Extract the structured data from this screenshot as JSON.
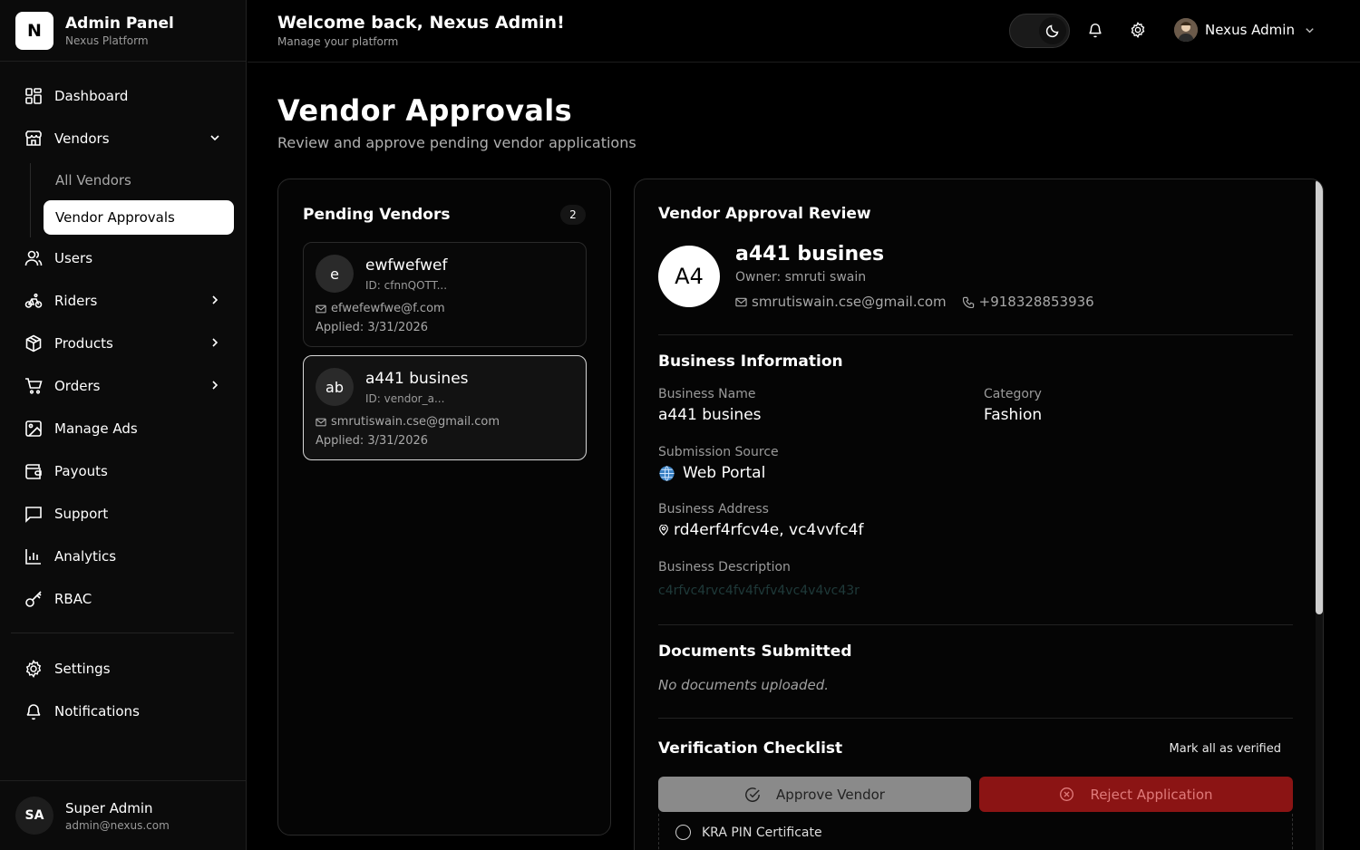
{
  "brand": {
    "logo": "N",
    "title": "Admin Panel",
    "subtitle": "Nexus Platform"
  },
  "nav": {
    "dashboard": "Dashboard",
    "vendors": "Vendors",
    "all_vendors": "All Vendors",
    "vendor_approvals": "Vendor Approvals",
    "users": "Users",
    "riders": "Riders",
    "products": "Products",
    "orders": "Orders",
    "manage_ads": "Manage Ads",
    "payouts": "Payouts",
    "support": "Support",
    "analytics": "Analytics",
    "rbac": "RBAC",
    "settings": "Settings",
    "notifications": "Notifications"
  },
  "footer_user": {
    "initials": "SA",
    "name": "Super Admin",
    "email": "admin@nexus.com"
  },
  "header": {
    "welcome": "Welcome back, Nexus Admin!",
    "subtitle": "Manage your platform",
    "profile_name": "Nexus Admin"
  },
  "page": {
    "title": "Vendor Approvals",
    "subtitle": "Review and approve pending vendor applications"
  },
  "pending": {
    "title": "Pending Vendors",
    "count": "2",
    "vendors": [
      {
        "initial": "e",
        "name": "ewfwefwef",
        "id": "ID: cfnnQOTT...",
        "email": "efwefewfwe@f.com",
        "applied": "Applied: 3/31/2026"
      },
      {
        "initial": "ab",
        "name": "a441 busines",
        "id": "ID: vendor_a...",
        "email": "smrutiswain.cse@gmail.com",
        "applied": "Applied: 3/31/2026"
      }
    ]
  },
  "review": {
    "title": "Vendor Approval Review",
    "avatar": "A4",
    "name": "a441 busines",
    "owner": "Owner: smruti swain",
    "email": "smrutiswain.cse@gmail.com",
    "phone": "+918328853936",
    "business_info_title": "Business Information",
    "business_name_label": "Business Name",
    "business_name": "a441 busines",
    "category_label": "Category",
    "category": "Fashion",
    "source_label": "Submission Source",
    "source": "Web Portal",
    "address_label": "Business Address",
    "address": "rd4erf4rfcv4e, vc4vvfc4f",
    "description_label": "Business Description",
    "description": "c4rfvc4rvc4fv4fvfv4vc4v4vc43r",
    "documents_title": "Documents Submitted",
    "no_documents": "No documents uploaded.",
    "checklist_title": "Verification Checklist",
    "mark_all": "Mark all as verified",
    "approve": "Approve Vendor",
    "reject": "Reject Application",
    "check_item": "KRA PIN Certificate"
  },
  "colors": {
    "accent_reject": "#8b1414",
    "approve_button": "#8a8a8a",
    "selected_nav": "#ffffff"
  }
}
